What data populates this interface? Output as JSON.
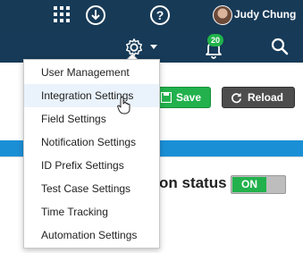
{
  "header": {
    "user_name": "Judy Chung",
    "icons": [
      "apps-grid-icon",
      "download-icon",
      "help-icon"
    ]
  },
  "nav": {
    "settings_icon": "gear-icon",
    "notifications_count": "20",
    "search_icon": "search-icon"
  },
  "toolbar": {
    "save_label": "Save",
    "reload_label": "Reload"
  },
  "section": {
    "status_label": "on status",
    "toggle_label": "ON"
  },
  "settings_menu": {
    "items": [
      {
        "label": "User Management"
      },
      {
        "label": "Integration Settings"
      },
      {
        "label": "Field Settings"
      },
      {
        "label": "Notification Settings"
      },
      {
        "label": "ID Prefix Settings"
      },
      {
        "label": "Test Case Settings"
      },
      {
        "label": "Time Tracking"
      },
      {
        "label": "Automation Settings"
      }
    ],
    "hovered_index": 1
  },
  "colors": {
    "header_bg": "#173a57",
    "accent_blue": "#1b8fd6",
    "save_green": "#22b14c",
    "reload_gray": "#4d4d4d"
  }
}
